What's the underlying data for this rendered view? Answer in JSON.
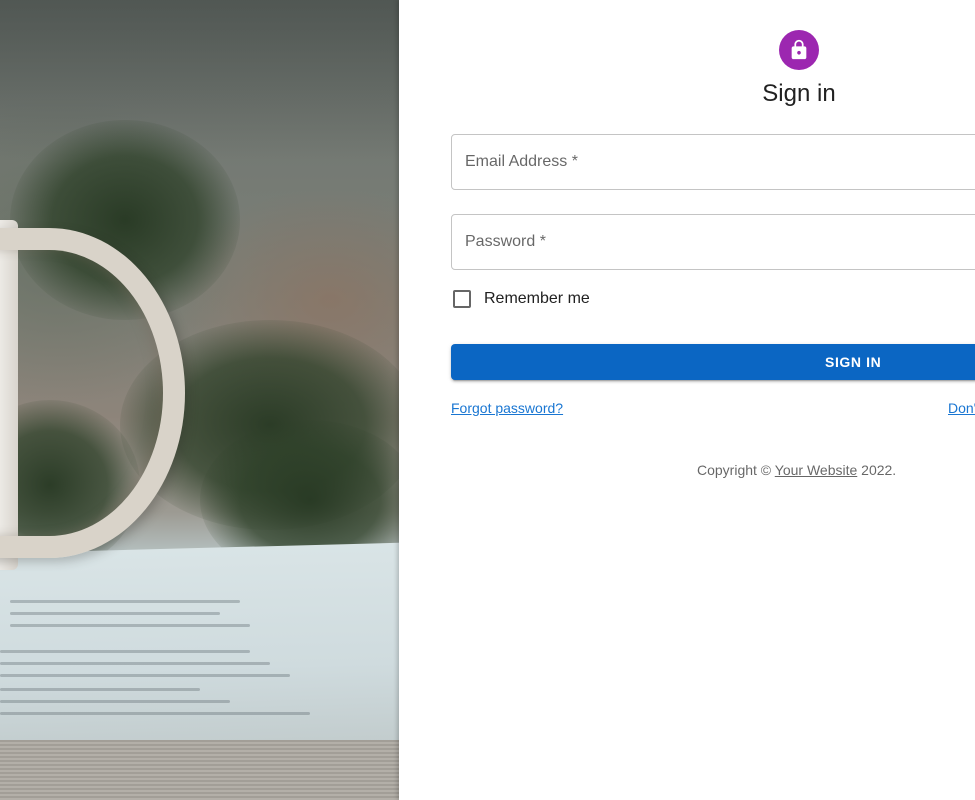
{
  "hero": {
    "image_description": "",
    "icon": "coffee-mug-book-photo"
  },
  "form": {
    "lock_icon": "lock-icon",
    "title": "Sign in",
    "email": {
      "label": "Email Address *",
      "value": ""
    },
    "password": {
      "label": "Password *",
      "value": ""
    },
    "remember_label": "Remember me",
    "submit_label": "SIGN IN",
    "forgot_link": "Forgot password?",
    "signup_link": "Don't have an account? Sign Up"
  },
  "footer": {
    "prefix": "Copyright © ",
    "site_link": "Your Website",
    "year_suffix": " 2022."
  },
  "colors": {
    "accent": "#9c27b0",
    "primary": "#0b66c3",
    "link": "#1976d2"
  }
}
